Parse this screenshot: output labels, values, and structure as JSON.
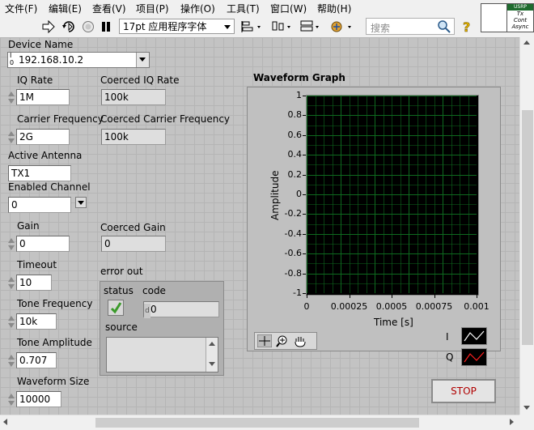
{
  "menu": [
    "文件(F)",
    "编辑(E)",
    "查看(V)",
    "项目(P)",
    "操作(O)",
    "工具(T)",
    "窗口(W)",
    "帮助(H)"
  ],
  "toolbar": {
    "font": "17pt 应用程序字体",
    "search_placeholder": "搜索"
  },
  "usrp_icon": {
    "line1": "USRP",
    "line2": "Tx",
    "line3": "Cont",
    "line4": "Async"
  },
  "controls": {
    "device_name": {
      "label": "Device Name",
      "value": "192.168.10.2",
      "prefix_top": "I",
      "prefix_bottom": "0"
    },
    "iq_rate": {
      "label": "IQ Rate",
      "value": "1M"
    },
    "coerced_iq_rate": {
      "label": "Coerced IQ Rate",
      "value": "100k"
    },
    "carrier_frequency": {
      "label": "Carrier Frequency",
      "value": "2G"
    },
    "coerced_carrier_frequency": {
      "label": "Coerced Carrier Frequency",
      "value": "100k"
    },
    "active_antenna": {
      "label": "Active Antenna",
      "value": "TX1"
    },
    "enabled_channel": {
      "label": "Enabled Channel",
      "value": "0"
    },
    "gain": {
      "label": "Gain",
      "value": "0"
    },
    "coerced_gain": {
      "label": "Coerced Gain",
      "value": "0"
    },
    "timeout": {
      "label": "Timeout",
      "value": "10"
    },
    "tone_frequency": {
      "label": "Tone Frequency",
      "value": "10k"
    },
    "tone_amplitude": {
      "label": "Tone Amplitude",
      "value": "0.707"
    },
    "waveform_size": {
      "label": "Waveform Size",
      "value": "10000"
    }
  },
  "error_out": {
    "label": "error out",
    "status_label": "status",
    "code_label": "code",
    "code_prefix": "d",
    "code_value": "0",
    "source_label": "source",
    "source_value": ""
  },
  "graph": {
    "title": "Waveform Graph",
    "ylabel": "Amplitude",
    "xlabel": "Time [s]",
    "yticks": [
      "1",
      "0.8",
      "0.6",
      "0.4",
      "0.2",
      "0",
      "-0.2",
      "-0.4",
      "-0.6",
      "-0.8",
      "-1"
    ],
    "xticks": [
      "0",
      "0.00025",
      "0.0005",
      "0.00075",
      "0.001"
    ],
    "legend": [
      {
        "name": "I",
        "color": "#ffffff"
      },
      {
        "name": "Q",
        "color": "#ff2020"
      }
    ]
  },
  "stop_label": "STOP",
  "colors": {
    "plot_bg": "#000000",
    "grid": "#0e6a1f",
    "stop_text": "#b00000",
    "check": "#3a9a2a"
  }
}
